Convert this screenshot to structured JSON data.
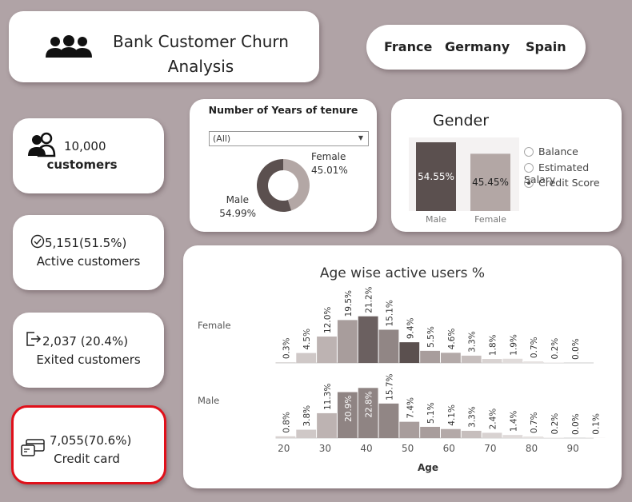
{
  "header": {
    "title": "Bank Customer Churn Analysis",
    "icon": "users-icon"
  },
  "countries": [
    "France",
    "Germany",
    "Spain"
  ],
  "stats": {
    "customers": {
      "value": "10,000",
      "label": "customers",
      "icon": "users-icon"
    },
    "active": {
      "value": "5,151(51.5%)",
      "label": "Active customers",
      "icon": "check-circle-icon"
    },
    "exited": {
      "value": "2,037 (20.4%)",
      "label": "Exited customers",
      "icon": "exit-icon"
    },
    "credit": {
      "value": "7,055(70.6%)",
      "label": "Credit card",
      "icon": "credit-card-icon"
    }
  },
  "tenure": {
    "title": "Number of Years of tenure",
    "filter_value": "(All)"
  },
  "gender": {
    "title": "Gender",
    "options": [
      "Balance",
      "Estimated Salary",
      "Credit Score"
    ],
    "selected": "Credit Score"
  },
  "colors": {
    "dark": "#5b504f",
    "light": "#b3a7a5",
    "accent": "#e0101a"
  },
  "chart_data": [
    {
      "type": "pie",
      "title": "",
      "categories": [
        "Male",
        "Female"
      ],
      "values": [
        54.99,
        45.01
      ],
      "labels": [
        "54.99%",
        "45.01%"
      ],
      "colors": [
        "#5b504f",
        "#b3a7a5"
      ]
    },
    {
      "type": "bar",
      "title": "",
      "categories": [
        "Male",
        "Female"
      ],
      "values": [
        54.55,
        45.45
      ],
      "labels": [
        "54.55%",
        "45.45%"
      ],
      "colors": [
        "#5b504f",
        "#b3a7a5"
      ]
    },
    {
      "type": "bar",
      "title": "Age wise active users %",
      "xlabel": "Age",
      "x_ticks": [
        20,
        30,
        40,
        50,
        60,
        70,
        80,
        90
      ],
      "bin_start": [
        18,
        23,
        28,
        33,
        38,
        43,
        48,
        53,
        58,
        63,
        68,
        73,
        78,
        83,
        88,
        93
      ],
      "bin_width": 5,
      "series": [
        {
          "name": "Female",
          "values": [
            0.3,
            4.5,
            12.0,
            19.5,
            21.2,
            15.1,
            9.4,
            5.5,
            4.6,
            3.3,
            1.8,
            1.9,
            0.7,
            0.2,
            0.0,
            null
          ],
          "labels": [
            "0.3%",
            "4.5%",
            "12.0%",
            "19.5%",
            "21.2%",
            "15.1%",
            "9.4%",
            "5.5%",
            "4.6%",
            "3.3%",
            "1.8%",
            "1.9%",
            "0.7%",
            "0.2%",
            "0.0%",
            null
          ]
        },
        {
          "name": "Male",
          "values": [
            0.8,
            3.8,
            11.3,
            20.9,
            22.8,
            15.7,
            7.4,
            5.1,
            4.1,
            3.3,
            2.4,
            1.4,
            0.7,
            0.2,
            0.0,
            0.1
          ],
          "labels": [
            "0.8%",
            "3.8%",
            "11.3%",
            "20.9%",
            "22.8%",
            "15.7%",
            "7.4%",
            "5.1%",
            "4.1%",
            "3.3%",
            "2.4%",
            "1.4%",
            "0.7%",
            "0.2%",
            "0.0%",
            "0.1%"
          ]
        }
      ]
    }
  ]
}
